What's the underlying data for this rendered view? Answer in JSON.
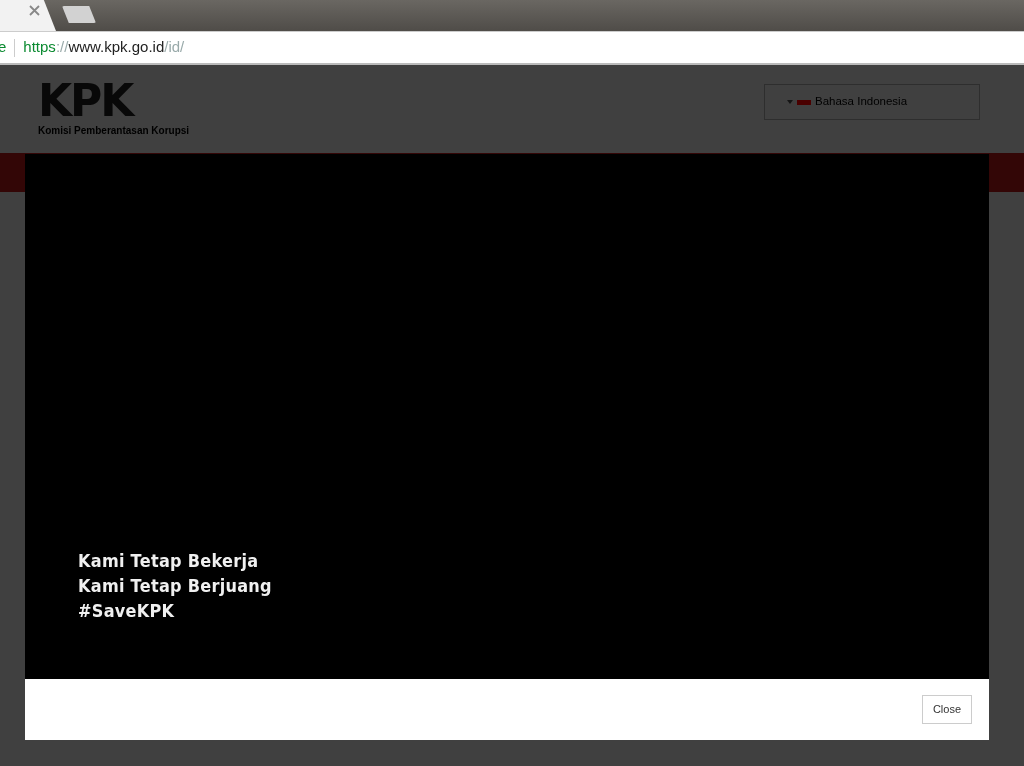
{
  "browser": {
    "tabs": [
      {
        "kind": "page",
        "selected": true
      },
      {
        "kind": "new",
        "selected": false
      }
    ],
    "address_bar": {
      "security_label": "e",
      "url": {
        "scheme": "https",
        "separator": "://",
        "host": "www.kpk.go.id",
        "path": "/id/"
      }
    }
  },
  "site": {
    "logo": {
      "text": "KPK",
      "subtitle": "Komisi Pemberantasan Korupsi"
    },
    "language": {
      "label": "Bahasa Indonesia"
    }
  },
  "modal": {
    "lines": [
      "Kami Tetap Bekerja",
      "Kami Tetap Berjuang",
      "#SaveKPK"
    ],
    "buttons": [
      "Close"
    ]
  }
}
